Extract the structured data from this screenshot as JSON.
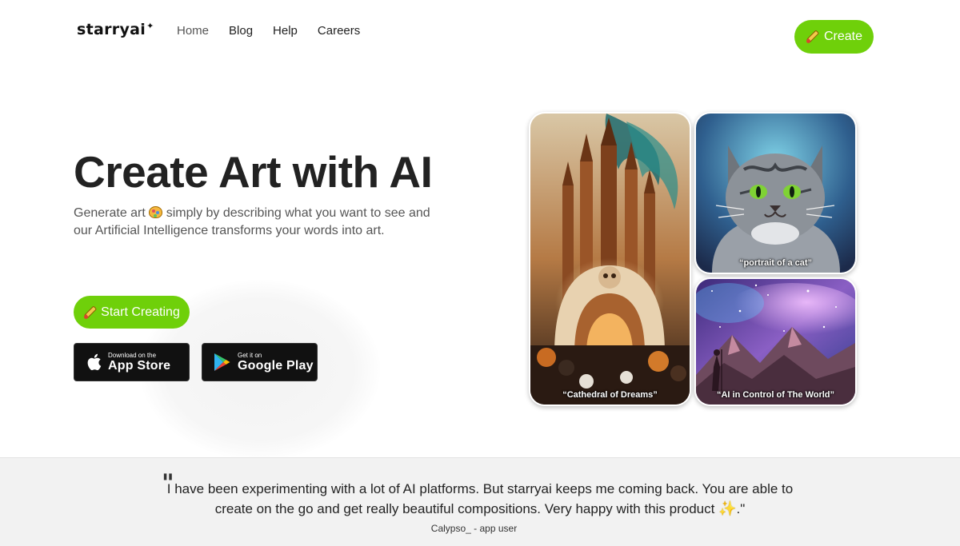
{
  "header": {
    "logo": "starryai",
    "logo_mark": "✦",
    "nav": [
      {
        "label": "Home"
      },
      {
        "label": "Blog"
      },
      {
        "label": "Help"
      },
      {
        "label": "Careers"
      }
    ],
    "create_label": "Create"
  },
  "hero": {
    "title": "Create Art with AI",
    "subtitle_before": "Generate art",
    "subtitle_after": "simply by describing what you want to see and our Artificial Intelligence transforms your words into art.",
    "start_label": "Start Creating",
    "app_store": {
      "small": "Download on the",
      "big": "App Store"
    },
    "google_play": {
      "small": "Get it on",
      "big": "Google Play"
    }
  },
  "gallery": [
    {
      "caption": "“Cathedral of Dreams”"
    },
    {
      "caption": "“portrait of a cat”"
    },
    {
      "caption": "“AI in Control of The World”"
    }
  ],
  "testimonial": {
    "quote_mark": "\"",
    "text_before": "I have been experimenting with a lot of AI platforms. But starryai keeps me coming back. You are able to create on the go and get really beautiful compositions. Very happy with this product",
    "text_after": ".\"",
    "author": "Calypso_ - app user"
  },
  "colors": {
    "accent": "#6fd00a",
    "dark_button": "#111111",
    "testimonial_bg": "#f2f2f2"
  },
  "icons": {
    "brush": "paintbrush-icon",
    "brain": "brain-emoji-icon",
    "apple": "apple-logo-icon",
    "google_play": "google-play-logo-icon",
    "sparkles": "sparkles-emoji-icon"
  }
}
